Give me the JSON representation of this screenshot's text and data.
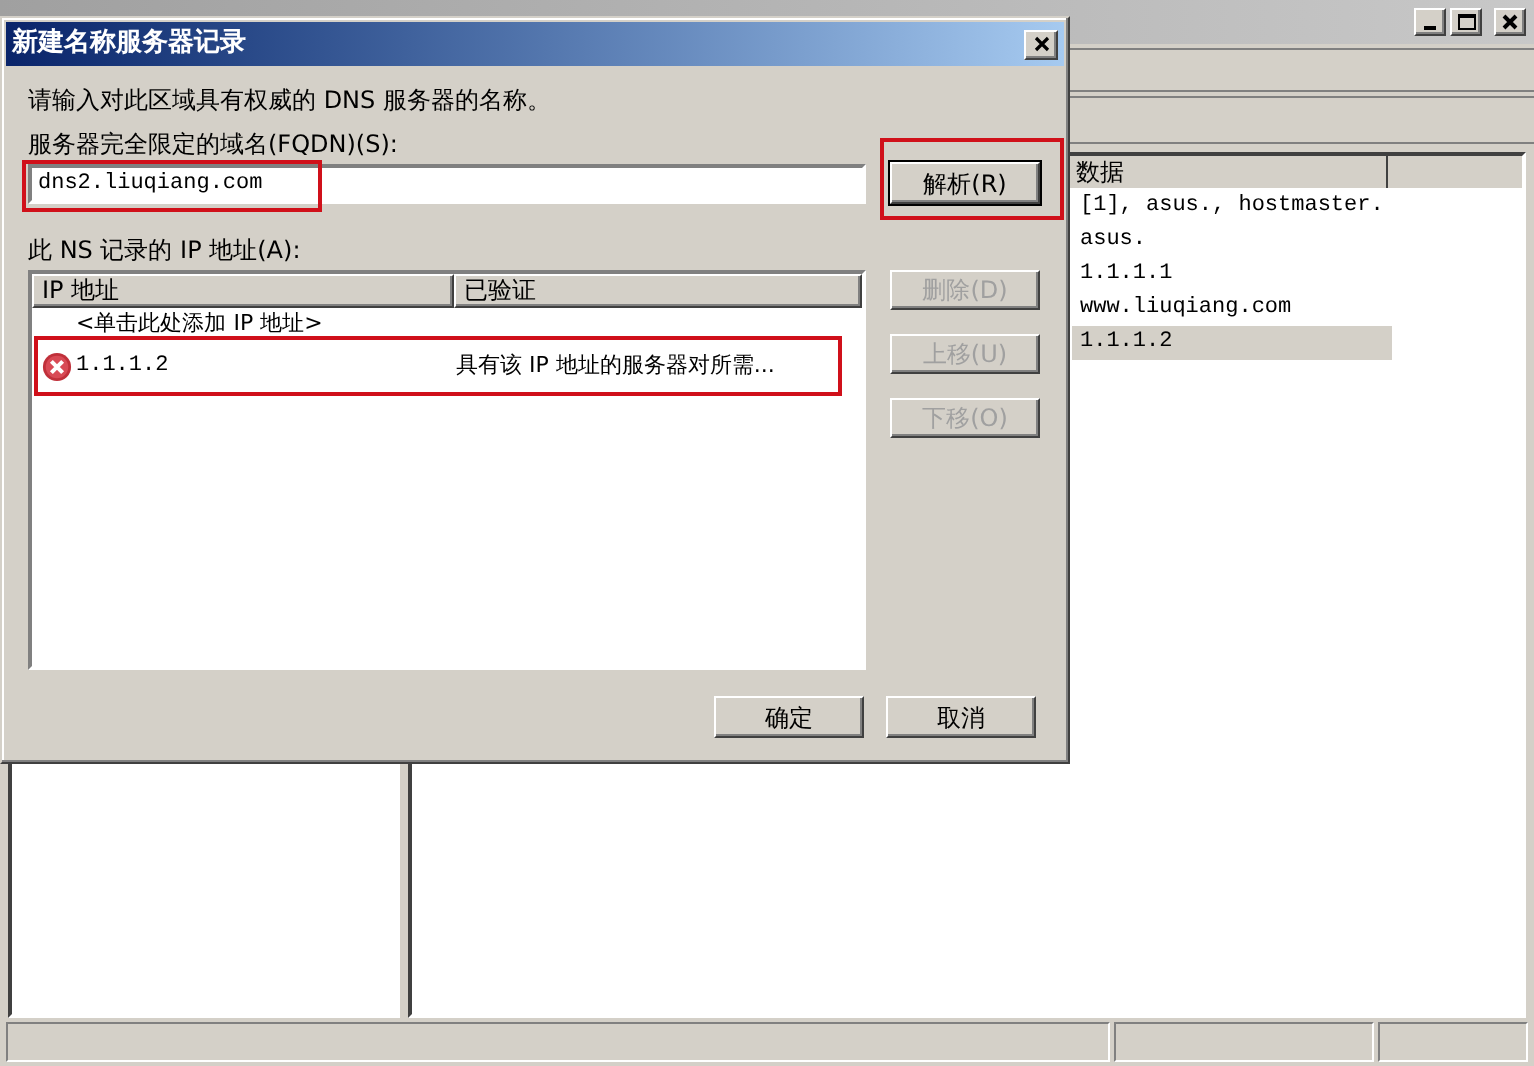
{
  "records": {
    "columns": [
      {
        "label": "数据"
      }
    ],
    "rows": [
      {
        "data": "[1], asus., hostmaster.",
        "selected": false
      },
      {
        "data": "asus.",
        "selected": false
      },
      {
        "data": "1.1.1.1",
        "selected": false
      },
      {
        "data": "www.liuqiang.com",
        "selected": false
      },
      {
        "data": "1.1.1.2",
        "selected": true
      }
    ]
  },
  "dialog": {
    "title": "新建名称服务器记录",
    "prompt": "请输入对此区域具有权威的 DNS 服务器的名称。",
    "fqdn_label": "服务器完全限定的域名(FQDN)(S):",
    "fqdn_value": "dns2.liuqiang.com",
    "resolve_button": "解析(R)",
    "ip_label": "此 NS 记录的 IP 地址(A):",
    "ip_table": {
      "columns": [
        {
          "label": "IP 地址"
        },
        {
          "label": "已验证"
        }
      ],
      "rows": [
        {
          "kind": "add",
          "ip": "<单击此处添加 IP 地址>"
        },
        {
          "kind": "error",
          "ip": "1.1.1.2",
          "status": "具有该 IP 地址的服务器对所需..."
        }
      ]
    },
    "side_buttons": [
      {
        "label": "删除(D)",
        "disabled": true
      },
      {
        "label": "上移(U)",
        "disabled": true
      },
      {
        "label": "下移(O)",
        "disabled": true
      }
    ],
    "ok_button": "确定",
    "cancel_button": "取消"
  }
}
